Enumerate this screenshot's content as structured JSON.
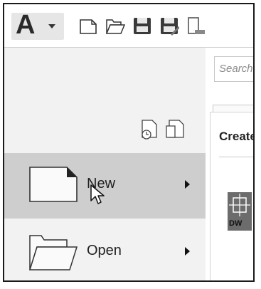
{
  "app": {
    "logo_letter": "A"
  },
  "toolbar": {
    "icons": [
      "new-file-icon",
      "open-folder-icon",
      "save-icon",
      "save-as-icon",
      "export-icon"
    ]
  },
  "search": {
    "placeholder": "Search"
  },
  "create_panel": {
    "title": "Create",
    "thumbnail_label": "DW"
  },
  "menu": {
    "items": [
      {
        "label": "New",
        "icon": "new-document-icon",
        "selected": true
      },
      {
        "label": "Open",
        "icon": "open-folder-icon",
        "selected": false
      }
    ],
    "recent_icons": [
      "recent-documents-icon",
      "open-documents-icon"
    ]
  },
  "colors": {
    "selected_bg": "#cecece",
    "panel_bg": "#f2f2f2",
    "frame_border": "#1a1a1a"
  }
}
